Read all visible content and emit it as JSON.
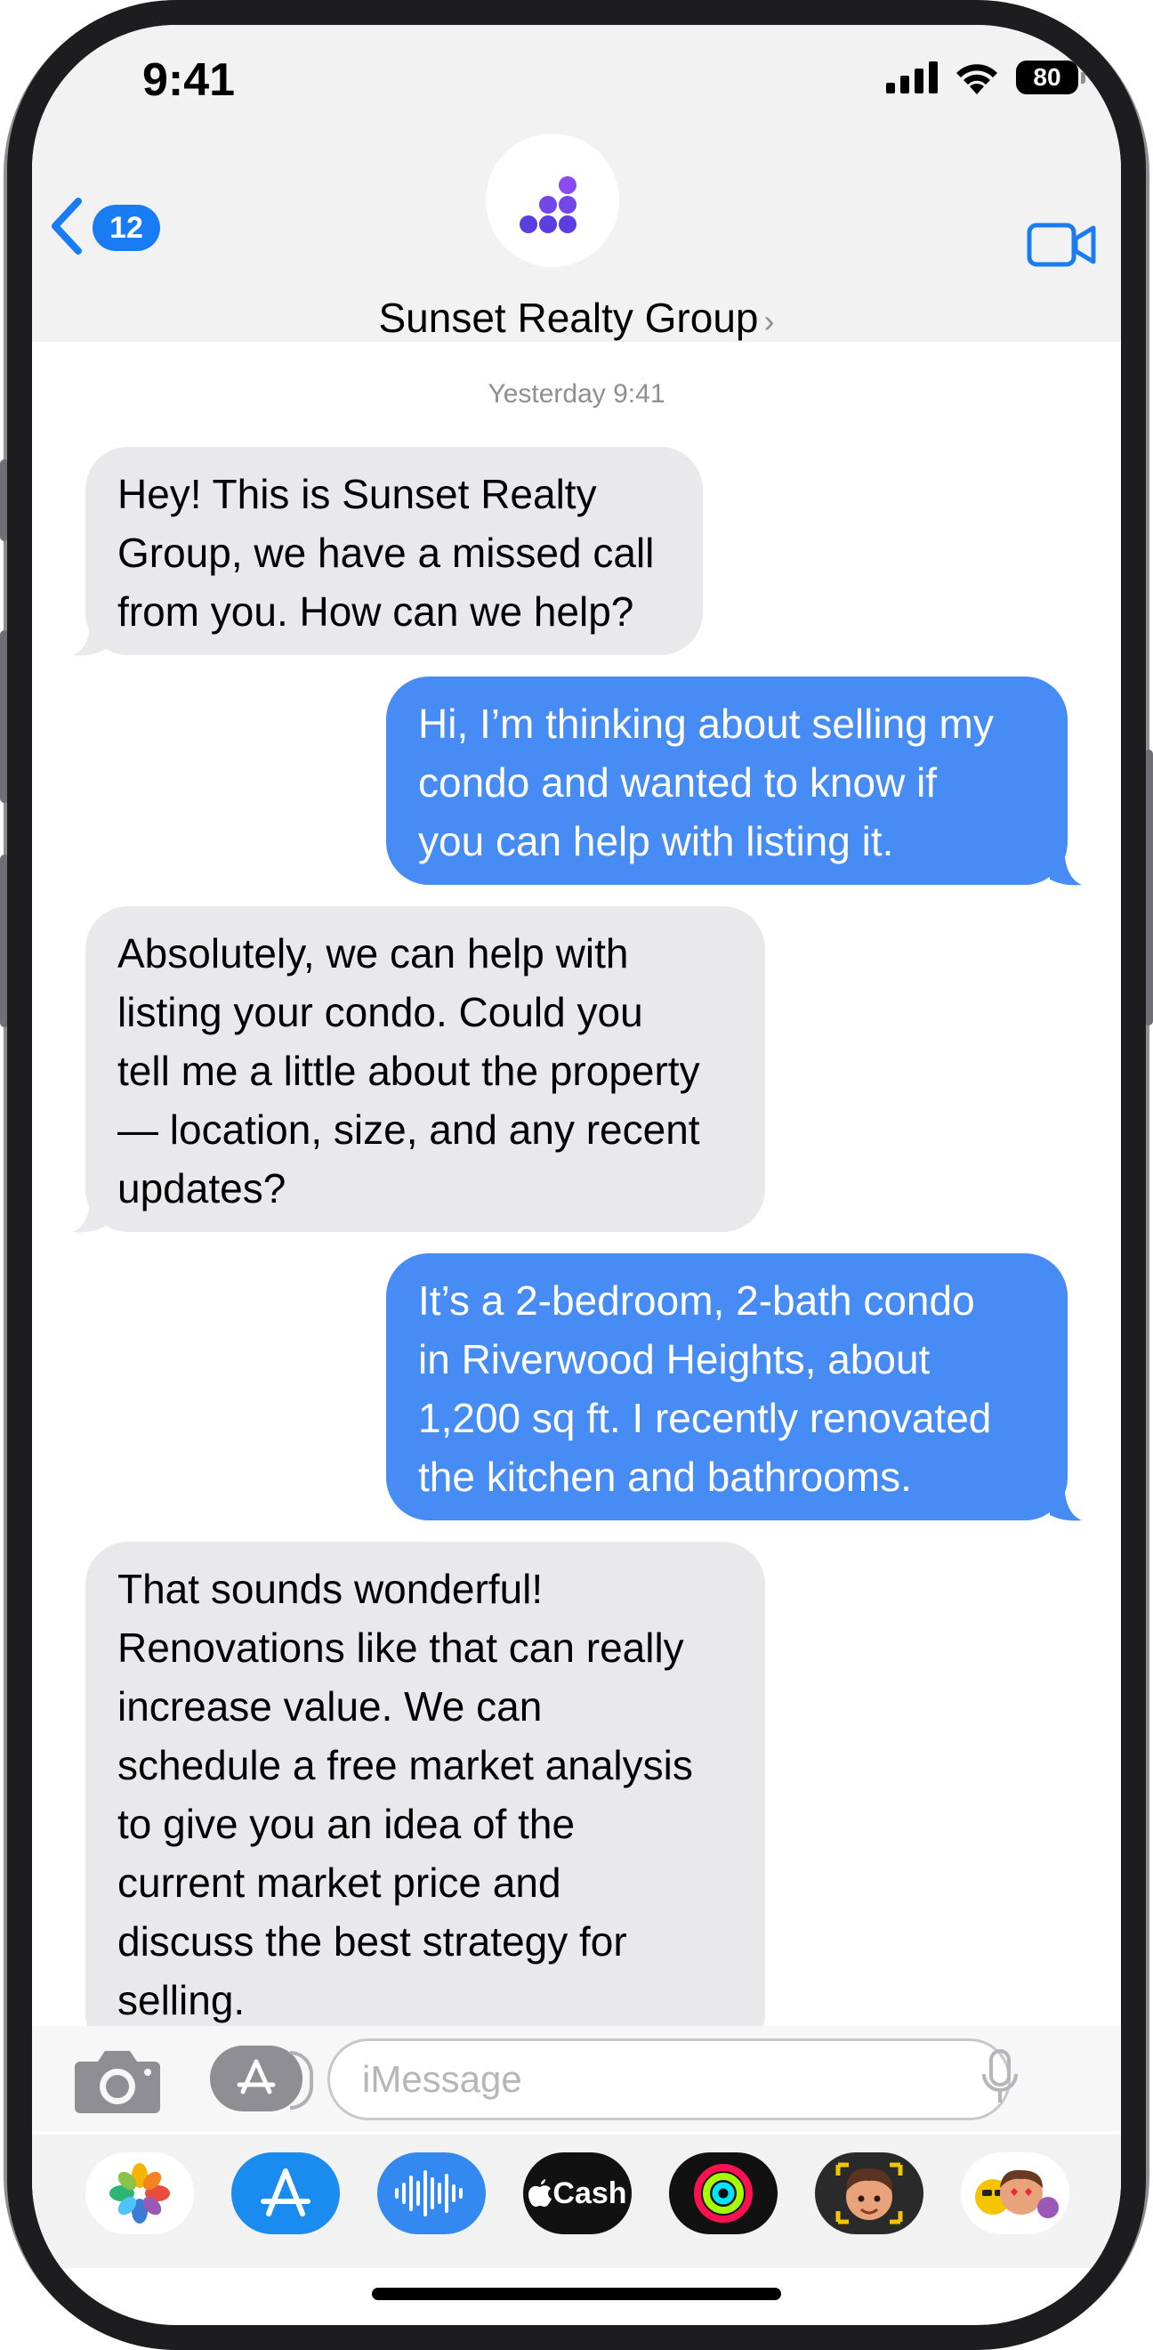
{
  "status_bar": {
    "time": "9:41",
    "battery": "80",
    "signal_icon": "cellular-signal-icon",
    "wifi_icon": "wifi-icon"
  },
  "header": {
    "back_badge": "12",
    "contact_name": "Sunset Realty Group",
    "name_chevron": "›",
    "accent_color": "#1a7cf2"
  },
  "conversation": {
    "timestamp": "Yesterday 9:41",
    "messages": [
      {
        "sender": "business",
        "lines": [
          "Hey! This is Sunset Realty",
          "Group, we have a missed call",
          "from you. How can we help?"
        ]
      },
      {
        "sender": "me",
        "lines": [
          "Hi, I’m thinking about selling my",
          "condo and wanted to know if",
          "you can help with listing it."
        ]
      },
      {
        "sender": "business",
        "lines": [
          "Absolutely, we can help with",
          "listing your condo. Could you",
          "tell me a little about the property",
          "— location, size, and any recent",
          "updates?"
        ]
      },
      {
        "sender": "me",
        "lines": [
          "It’s a 2-bedroom, 2-bath condo",
          "in Riverwood Heights, about",
          "1,200 sq ft. I recently renovated",
          "the kitchen and bathrooms."
        ]
      },
      {
        "sender": "business",
        "lines": [
          "That sounds wonderful!",
          "Renovations like that can really",
          "increase value. We can",
          "schedule a free market analysis",
          "to give you an idea of the",
          "current market price and",
          "discuss the best strategy for",
          "selling."
        ]
      }
    ],
    "incoming_color": "#e9e9eb",
    "outgoing_color": "#468cf4"
  },
  "composer": {
    "placeholder": "iMessage"
  },
  "app_drawer": {
    "apps": [
      "photos-app",
      "app-store-app",
      "audio-message-app",
      "apple-cash-app",
      "fitness-activity-app",
      "memoji-app",
      "animoji-stickers-app"
    ],
    "cash_label": "Cash"
  }
}
